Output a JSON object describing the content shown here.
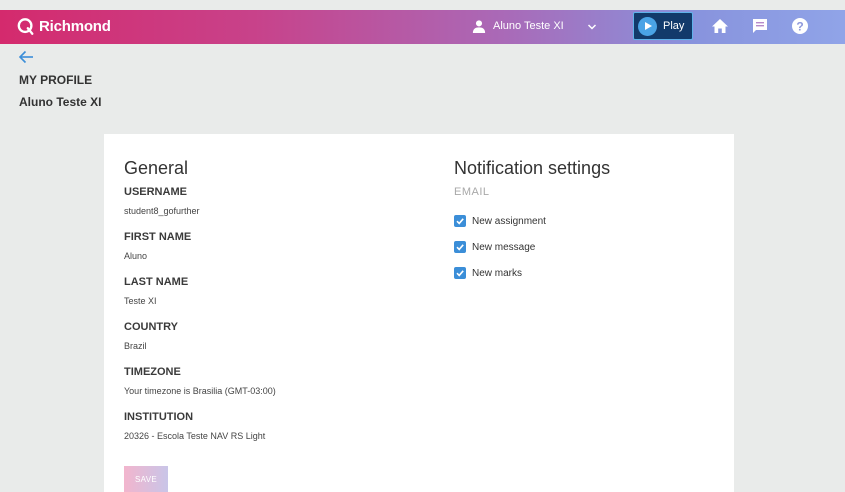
{
  "header": {
    "brand": "Richmond",
    "user_name": "Aluno Teste XI",
    "play_label": "Play",
    "icons": [
      "richmond-logo-icon",
      "user-icon",
      "chevron-down-icon",
      "play-icon",
      "home-icon",
      "messages-icon",
      "help-icon"
    ]
  },
  "page": {
    "title": "MY PROFILE",
    "subtitle": "Aluno Teste XI"
  },
  "general": {
    "heading": "General",
    "fields": [
      {
        "label": "USERNAME",
        "value": "student8_gofurther"
      },
      {
        "label": "FIRST NAME",
        "value": "Aluno"
      },
      {
        "label": "LAST NAME",
        "value": "Teste XI"
      },
      {
        "label": "COUNTRY",
        "value": "Brazil"
      },
      {
        "label": "TIMEZONE",
        "value": "Your timezone is Brasilia (GMT-03:00)"
      },
      {
        "label": "INSTITUTION",
        "value": "20326 - Escola Teste NAV RS Light"
      }
    ],
    "save_label": "SAVE"
  },
  "notifications": {
    "heading": "Notification settings",
    "email_label": "EMAIL",
    "options": [
      {
        "label": "New assignment",
        "checked": true
      },
      {
        "label": "New message",
        "checked": true
      },
      {
        "label": "New marks",
        "checked": true
      }
    ]
  },
  "colors": {
    "brand_gradient_start": "#d42a6d",
    "brand_gradient_end": "#90a4e8",
    "checkbox": "#3b8ed8",
    "background": "#e9ebea"
  }
}
